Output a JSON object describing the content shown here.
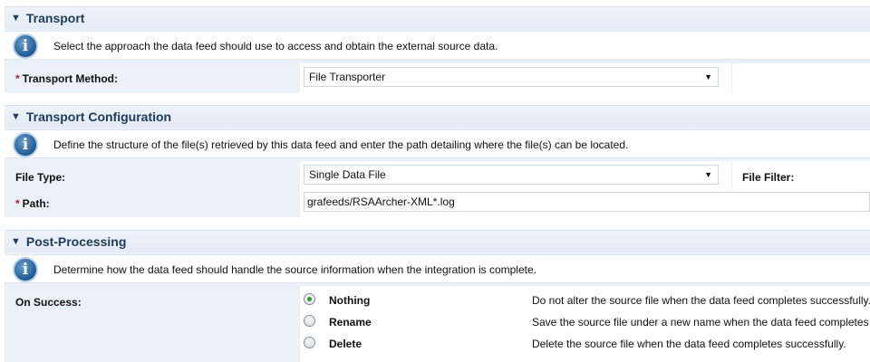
{
  "transport": {
    "title": "Transport",
    "info": "Select the approach the data feed should use to access and obtain the external source data.",
    "method_label": "Transport Method:",
    "method_value": "File Transporter"
  },
  "config": {
    "title": "Transport Configuration",
    "info": "Define the structure of the file(s) retrieved by this data feed and enter the path detailing where the file(s) can be located.",
    "file_type_label": "File Type:",
    "file_type_value": "Single Data File",
    "file_filter_label": "File Filter:",
    "path_label": "Path:",
    "path_value": "grafeeds/RSAArcher-XML*.log"
  },
  "post": {
    "title": "Post-Processing",
    "info": "Determine how the data feed should handle the source information when the integration is complete.",
    "on_success_label": "On Success:",
    "options": [
      {
        "label": "Nothing",
        "desc": "Do not alter the source file when the data feed completes successfully.",
        "selected": true
      },
      {
        "label": "Rename",
        "desc": "Save the source file under a new name when the data feed completes",
        "selected": false
      },
      {
        "label": "Delete",
        "desc": "Delete the source file when the data feed completes successfully.",
        "selected": false
      }
    ]
  },
  "icons": {
    "collapse": "triangle-down-icon",
    "info": "info-icon",
    "dropdown": "chevron-down-icon"
  },
  "symbols": {
    "required": "*",
    "info_glyph": "i",
    "triangle": "▼",
    "arrow": "▼"
  },
  "colors": {
    "header_text": "#1d3b5c",
    "required": "#c0182e",
    "radio_selected": "#2f9a2f",
    "section_bg": "#ebf1f8"
  }
}
